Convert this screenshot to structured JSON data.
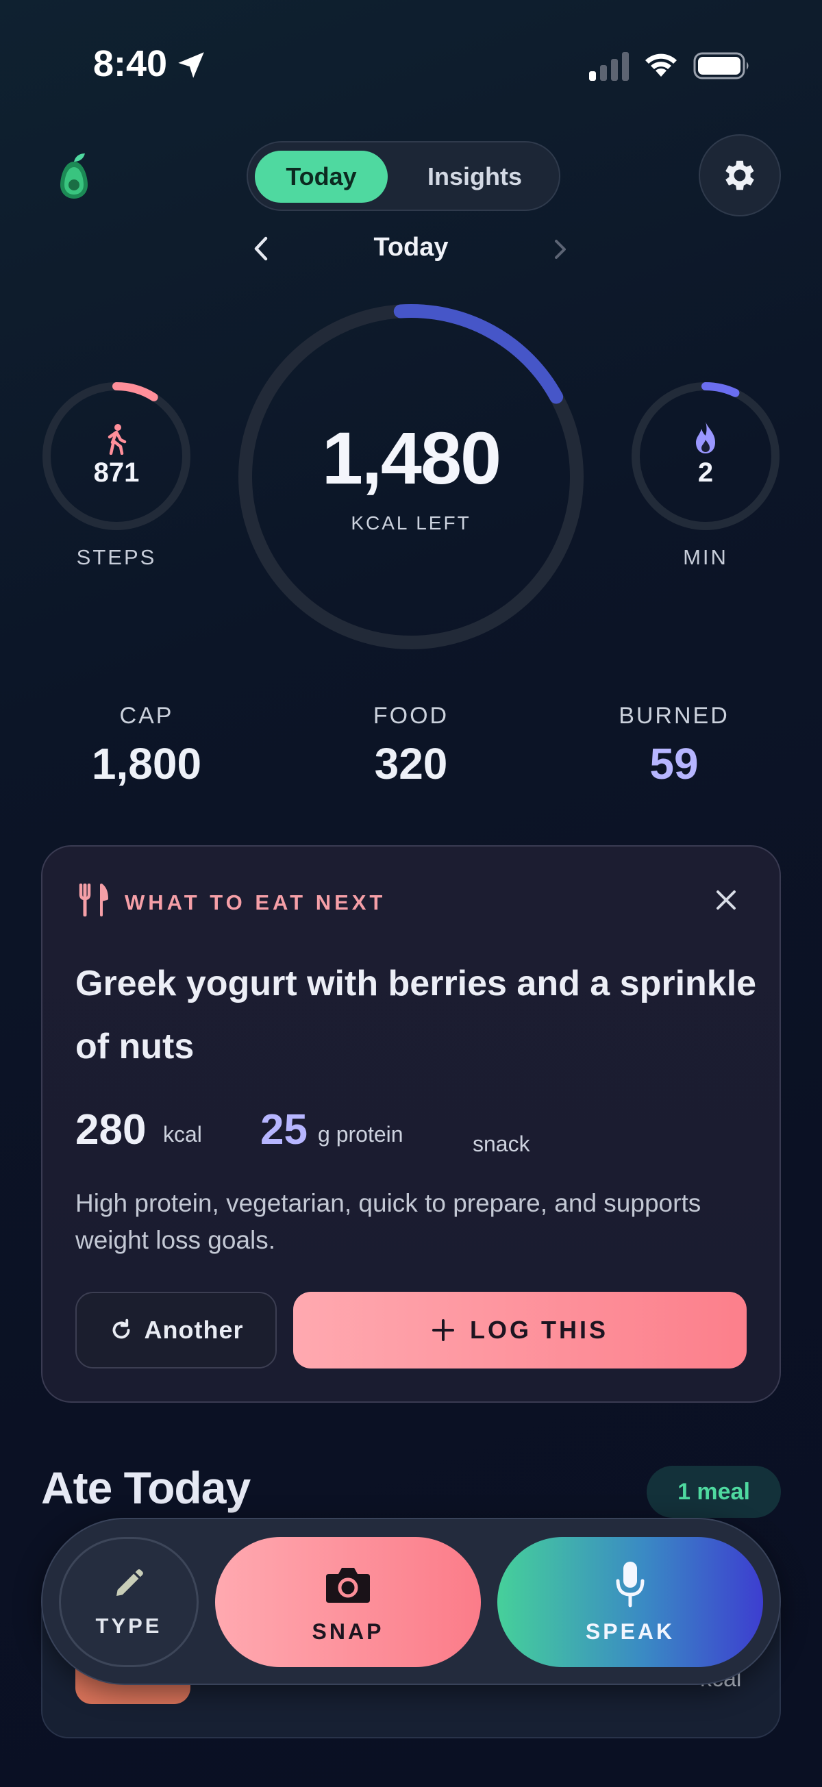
{
  "status_bar": {
    "time": "8:40"
  },
  "header": {
    "tabs": [
      {
        "label": "Today",
        "active": true
      },
      {
        "label": "Insights",
        "active": false
      }
    ]
  },
  "date_nav": {
    "label": "Today"
  },
  "rings": {
    "steps": {
      "value": "871",
      "label": "STEPS",
      "progress": 0.09
    },
    "calories": {
      "value": "1,480",
      "label": "KCAL LEFT",
      "progress": 0.18
    },
    "minutes": {
      "value": "2",
      "label": "MIN",
      "progress": 0.07
    }
  },
  "stats": [
    {
      "label": "CAP",
      "value": "1,800"
    },
    {
      "label": "FOOD",
      "value": "320"
    },
    {
      "label": "BURNED",
      "value": "59"
    }
  ],
  "suggestion": {
    "eyebrow": "WHAT TO EAT NEXT",
    "title": "Greek yogurt with berries and a sprinkle of nuts",
    "kcal_value": "280",
    "kcal_unit": "kcal",
    "protein_value": "25",
    "protein_unit": "g protein",
    "meal_type": "snack",
    "description": "High protein, vegetarian, quick to prepare, and supports weight loss goals.",
    "another_label": "Another",
    "log_label": "LOG THIS"
  },
  "ate_today": {
    "title": "Ate Today",
    "badge": "1 meal",
    "meal_unit": "kcal"
  },
  "actions": {
    "type_label": "TYPE",
    "snap_label": "SNAP",
    "speak_label": "SPEAK"
  },
  "colors": {
    "accent_green": "#4fd9a0",
    "accent_pink": "#fc7f8b",
    "accent_indigo": "#6b6ef0",
    "steps_ring": "#ff8f9a",
    "calorie_ring": "#4656c8",
    "burned_text": "#b7b6ff"
  },
  "icons": {
    "logo": "avocado-logo",
    "settings": "gear-icon",
    "steps": "walk-icon",
    "minutes": "flame-icon",
    "suggestion": "fork-knife-icon",
    "another": "refresh-icon",
    "log": "plus-icon",
    "type": "pencil-icon",
    "snap": "camera-icon",
    "speak": "microphone-icon"
  }
}
